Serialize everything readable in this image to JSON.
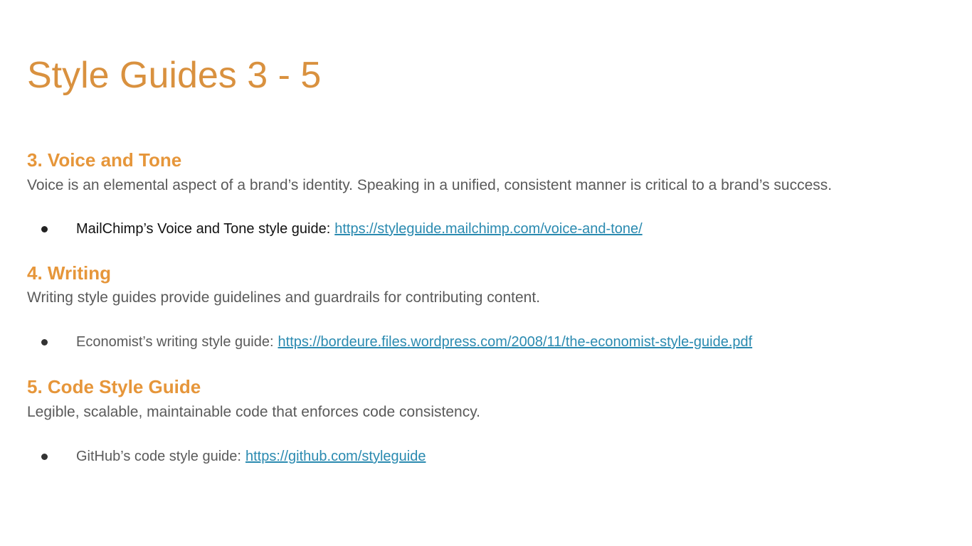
{
  "slide": {
    "title": "Style Guides 3 - 5",
    "sections": [
      {
        "heading": "3. Voice and Tone",
        "description": "Voice is an elemental aspect of a brand’s identity. Speaking in a unified, consistent manner is critical to a brand’s success.",
        "bullet": {
          "text": "MailChimp’s Voice and Tone style guide:",
          "link": "https://styleguide.mailchimp.com/voice-and-tone/"
        }
      },
      {
        "heading": "4. Writing",
        "description": "Writing style guides provide guidelines and guardrails for contributing content.",
        "bullet": {
          "text": "Economist’s writing style guide:",
          "link": "https://bordeure.files.wordpress.com/2008/11/the-economist-style-guide.pdf"
        }
      },
      {
        "heading": "5. Code Style Guide",
        "description": "Legible, scalable, maintainable code that enforces code consistency.",
        "bullet": {
          "text": "GitHub’s code style guide:",
          "link": "https://github.com/styleguide"
        }
      }
    ]
  },
  "colors": {
    "title": "#d9913f",
    "heading": "#e6963a",
    "body_text": "#5a5a5a",
    "link": "#2a8ab0"
  }
}
